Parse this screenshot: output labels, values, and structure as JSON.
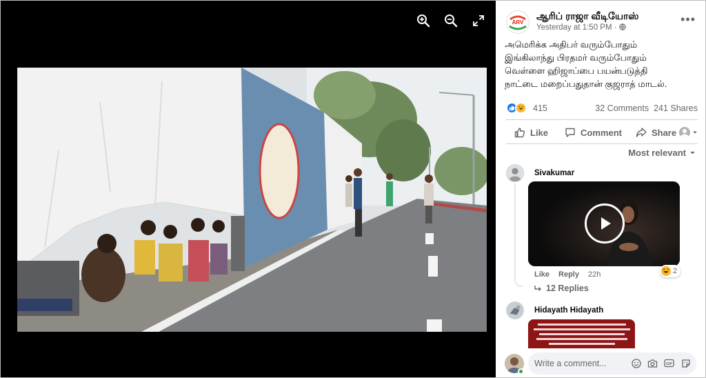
{
  "viewer": {
    "tools": [
      {
        "icon": "zoom-in-icon"
      },
      {
        "icon": "zoom-out-icon"
      },
      {
        "icon": "fullscreen-icon"
      }
    ]
  },
  "post": {
    "page_name": "ஆரிப் ராஜா வீடியோஸ்",
    "page_logo_text": "ARV",
    "time": "Yesterday at 1:50 PM · ",
    "privacy_icon": "globe-icon",
    "text_lines": [
      "அமெரிக்க அதிபர் வரும்போதும்",
      "இங்கிலாந்து பிரதமர் வரும்போதும்",
      "வெள்ளை ஹிஜாப்பை பயன்படுத்தி",
      "நாட்டை மறைப்பதுதான் குஜராத் மாடல்."
    ],
    "reaction_count": "415",
    "comments": "32 Comments",
    "shares": "241 Shares",
    "actions": {
      "like": "Like",
      "comment": "Comment",
      "share": "Share"
    },
    "sort": "Most relevant"
  },
  "comments": [
    {
      "name": "Sivakumar",
      "like": "Like",
      "reply": "Reply",
      "time": "22h",
      "reaction_count": "2",
      "replies": "12 Replies"
    },
    {
      "name": "Hidayath Hidayath"
    }
  ],
  "composer": {
    "placeholder": "Write a comment..."
  },
  "colors": {
    "viewer_bg": "#000000",
    "link_blue": "#1877f2",
    "meta_grey": "#65676b"
  }
}
